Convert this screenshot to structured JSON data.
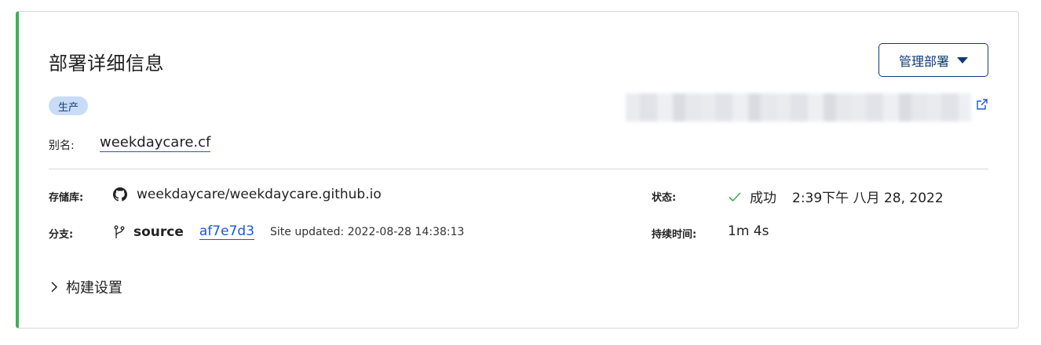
{
  "card": {
    "title": "部署详细信息",
    "manage_button_label": "管理部署",
    "environment_badge": "生产"
  },
  "alias": {
    "label": "别名:",
    "value": "weekdaycare.cf"
  },
  "repository": {
    "label": "存储库:",
    "value": "weekdaycare/weekdaycare.github.io",
    "icon": "github-icon"
  },
  "branch": {
    "label": "分支:",
    "name": "source",
    "commit": "af7e7d3",
    "message": "Site updated: 2022-08-28 14:38:13",
    "icon": "branch-icon"
  },
  "status": {
    "label": "状态:",
    "value": "成功",
    "timestamp": "2:39下午 八月 28, 2022",
    "icon": "check-icon",
    "color": "#3fae59"
  },
  "duration": {
    "label": "持续时间:",
    "value": "1m 4s"
  },
  "build_settings": {
    "label": "构建设置",
    "icon": "chevron-right-icon"
  },
  "colors": {
    "accent_border": "#3fae59",
    "primary": "#0e3b77",
    "link": "#1a56db",
    "badge_bg": "#c9dcf7"
  }
}
